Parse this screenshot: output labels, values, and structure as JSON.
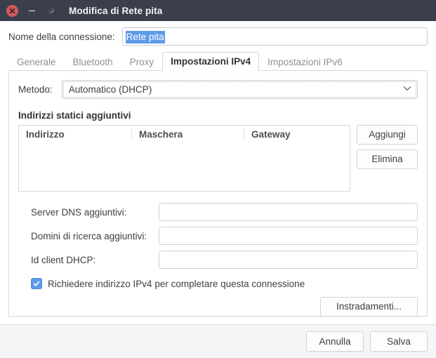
{
  "titlebar": {
    "title": "Modifica di Rete pita",
    "close_icon": "close-icon",
    "minimize_icon": "minimize-icon",
    "maximize_icon": "restore-icon"
  },
  "connection": {
    "name_label": "Nome della connessione:",
    "name_value": "Rete pita",
    "name_placeholder": ""
  },
  "tabs": [
    {
      "label": "Generale",
      "active": false
    },
    {
      "label": "Bluetooth",
      "active": false
    },
    {
      "label": "Proxy",
      "active": false
    },
    {
      "label": "Impostazioni IPv4",
      "active": true
    },
    {
      "label": "Impostazioni IPv6",
      "active": false
    }
  ],
  "ipv4": {
    "method_label": "Metodo:",
    "method_value": "Automatico (DHCP)",
    "method_chevron": "chevron-down-icon",
    "static_section_title": "Indirizzi statici aggiuntivi",
    "table_columns": [
      "Indirizzo",
      "Maschera",
      "Gateway"
    ],
    "table_rows": [],
    "add_button": "Aggiungi",
    "delete_button": "Elimina",
    "dns_label": "Server DNS aggiuntivi:",
    "dns_value": "",
    "dns_placeholder": "",
    "search_domains_label": "Domini di ricerca aggiuntivi:",
    "search_domains_value": "",
    "search_domains_placeholder": "",
    "dhcp_client_id_label": "Id client DHCP:",
    "dhcp_client_id_value": "",
    "dhcp_client_id_placeholder": "",
    "require_ipv4_label": "Richiedere indirizzo IPv4 per completare questa connessione",
    "require_ipv4_checked": true,
    "check_icon": "check-icon",
    "routes_button": "Instradamenti..."
  },
  "actions": {
    "cancel": "Annulla",
    "save": "Salva"
  },
  "colors": {
    "titlebar_bg": "#3a3f4b",
    "close_button": "#d2595b",
    "selection_blue": "#5e9aea",
    "checkbox_blue": "#5e9aea",
    "actionbar_bg": "#f4f5f7"
  }
}
